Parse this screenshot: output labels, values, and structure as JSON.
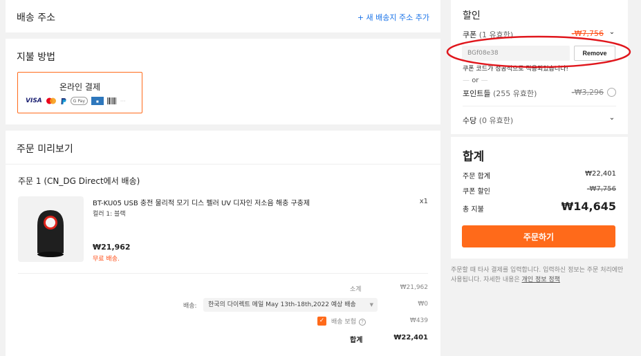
{
  "address": {
    "title": "배송 주소",
    "add_link": "+ 새 배송지 주소 추가"
  },
  "payment": {
    "title": "지불 방법",
    "option_label": "온라인 결제",
    "logos": [
      "VISA",
      "G Pay",
      "···"
    ]
  },
  "order": {
    "title": "주문 미리보기",
    "seller": "주문 1 (CN_DG Direct에서 배송)",
    "product_name": "BT-KU05 USB 충전 물리적 모기 디스 펠러 UV 디자인 저소음 해충 구충제",
    "qty": "x1",
    "variant": "컬러 1: 블랙",
    "price": "₩21,962",
    "shipping_free": "무료 배송.",
    "subtotal_label": "소계",
    "subtotal_value": "₩21,962",
    "shipping_label": "배송:",
    "shipping_method": "한국의 다이렉트 메일 May 13th-18th,2022 예상 배송",
    "shipping_value": "₩0",
    "insurance_label": "배송 보험",
    "insurance_value": "₩439",
    "total_label": "합계",
    "total_value": "₩22,401"
  },
  "discount": {
    "title": "할인",
    "coupon_label": "쿠폰",
    "coupon_count": "(1 유효한)",
    "coupon_value": "-₩7,756",
    "code": "BGf08e38",
    "remove_label": "Remove",
    "success_msg": "쿠폰 코드가 성공적으로 적용되었습니다!",
    "or": "or",
    "points_label": "포인트들",
    "points_count": "(255 유효한)",
    "points_value": "-₩3,296",
    "method_label": "수당",
    "method_count": "(0 유효한)"
  },
  "summary": {
    "title": "합계",
    "order_total_label": "주문 합계",
    "order_total_value": "₩22,401",
    "coupon_disc_label": "쿠폰 할인",
    "coupon_disc_value": "-₩7,756",
    "grand_label": "총 지불",
    "grand_value": "₩14,645",
    "cta": "주문하기"
  },
  "footer_note": {
    "text": "주문할 때 타사 결제를 입력합니다. 입력하신 정보는 주문 처리에만 사용됩니다. 자세한 내용은 ",
    "link": "개인 정보 정책"
  },
  "colors": {
    "accent": "#ff6a1a",
    "discount_red": "#ff4e17",
    "annotation": "#e0161c",
    "link_blue": "#1a73e8"
  }
}
